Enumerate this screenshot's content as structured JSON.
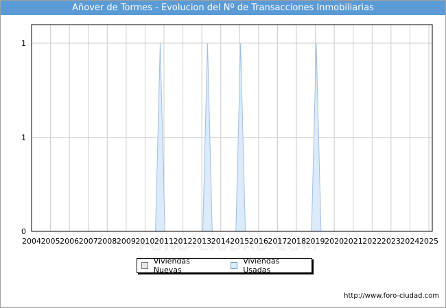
{
  "title": "Añover de Tormes - Evolucion del Nº de Transacciones Inmobiliarias",
  "watermark": "FORO-CIUDAD.COM",
  "source_url": "http://www.foro-ciudad.com",
  "colors": {
    "title_bg": "#5b9bd5",
    "grid": "#cccccc",
    "nuevas_fill": "#e8e8e8",
    "usadas_fill": "#dcebfa",
    "usadas_line": "#9dbfe8"
  },
  "chart_data": {
    "type": "area",
    "title": "Añover de Tormes - Evolucion del Nº de Transacciones Inmobiliarias",
    "xlabel": "",
    "ylabel": "",
    "x": [
      2004,
      2005,
      2006,
      2007,
      2008,
      2009,
      2010,
      2011,
      2012,
      2013,
      2014,
      2015,
      2016,
      2017,
      2018,
      2019,
      2020,
      2021,
      2022,
      2023,
      2024,
      2025
    ],
    "xlim": [
      2004,
      2025
    ],
    "ylim": [
      0,
      1
    ],
    "y_ticks": [
      {
        "value": 0,
        "label": "0"
      },
      {
        "value": 0.5,
        "label": "1"
      },
      {
        "value": 1,
        "label": "1"
      }
    ],
    "series": [
      {
        "name": "Viviendas Nuevas",
        "values": [
          0,
          0,
          0,
          0,
          0,
          0,
          0,
          0,
          0,
          0,
          0,
          0,
          0,
          0,
          0,
          0,
          0,
          0,
          0,
          0,
          0,
          0
        ]
      },
      {
        "name": "Viviendas Usadas",
        "points": [
          [
            2010.55,
            0
          ],
          [
            2010.8,
            1
          ],
          [
            2011.05,
            0
          ],
          [
            2013.05,
            0
          ],
          [
            2013.3,
            1
          ],
          [
            2013.55,
            0
          ],
          [
            2014.8,
            0
          ],
          [
            2015.05,
            1
          ],
          [
            2015.3,
            0
          ],
          [
            2018.8,
            0
          ],
          [
            2019.05,
            1
          ],
          [
            2019.3,
            0
          ]
        ]
      }
    ],
    "grid": true,
    "legend_position": "bottom-center"
  }
}
